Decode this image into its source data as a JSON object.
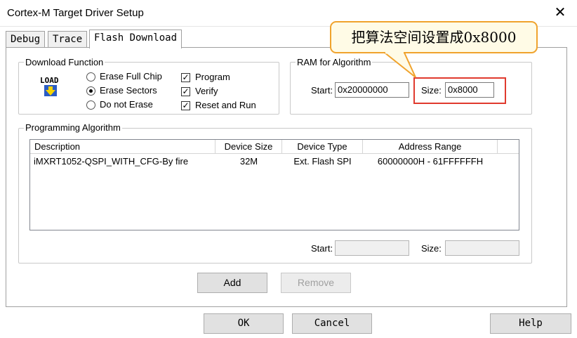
{
  "window": {
    "title": "Cortex-M Target Driver Setup",
    "close_glyph": "✕"
  },
  "tabs": [
    {
      "label": "Debug",
      "active": false
    },
    {
      "label": "Trace",
      "active": false
    },
    {
      "label": "Flash Download",
      "active": true
    }
  ],
  "download_function": {
    "group_label": "Download Function",
    "icon_text": "LOAD",
    "radios": [
      {
        "label": "Erase Full Chip",
        "selected": false
      },
      {
        "label": "Erase Sectors",
        "selected": true
      },
      {
        "label": "Do not Erase",
        "selected": false
      }
    ],
    "checkboxes": [
      {
        "label": "Program",
        "checked": true
      },
      {
        "label": "Verify",
        "checked": true
      },
      {
        "label": "Reset and Run",
        "checked": true
      }
    ],
    "check_glyph": "✓"
  },
  "ram": {
    "group_label": "RAM for Algorithm",
    "start_label": "Start:",
    "start_value": "0x20000000",
    "size_label": "Size:",
    "size_value": "0x8000"
  },
  "programming_algorithm": {
    "group_label": "Programming Algorithm",
    "columns": [
      "Description",
      "Device Size",
      "Device Type",
      "Address Range"
    ],
    "rows": [
      {
        "description": "iMXRT1052-QSPI_WITH_CFG-By fire",
        "size": "32M",
        "type": "Ext. Flash SPI",
        "range": "60000000H - 61FFFFFFH"
      }
    ],
    "start_label": "Start:",
    "start_value": "",
    "size_label": "Size:",
    "size_value": ""
  },
  "buttons": {
    "add": "Add",
    "remove": "Remove",
    "ok": "OK",
    "cancel": "Cancel",
    "help": "Help"
  },
  "annotation": {
    "callout_text": "把算法空间设置成0x8000",
    "callout_color": "#f0a32d",
    "highlight_color": "#e03a2e"
  }
}
